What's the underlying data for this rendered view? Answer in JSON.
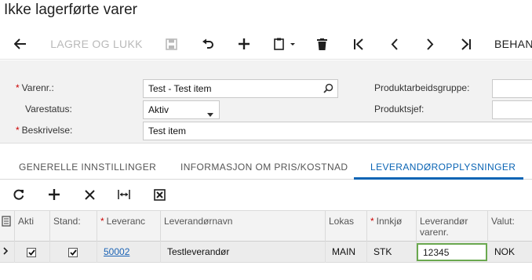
{
  "page": {
    "title": "Ikke lagerførte varer"
  },
  "toolbar": {
    "save_close_label": "LAGRE OG LUKK",
    "behan_label": "BEHAN",
    "icons": [
      "back-arrow-icon",
      "save-icon",
      "undo-icon",
      "plus-icon",
      "copy-paste-icon",
      "trash-icon",
      "first-record-icon",
      "prev-record-icon",
      "next-record-icon",
      "last-record-icon"
    ]
  },
  "form": {
    "varenr_label": "Varenr.:",
    "varenr_value": "Test - Test item",
    "varestatus_label": "Varestatus:",
    "varestatus_value": "Aktiv",
    "beskrivelse_label": "Beskrivelse:",
    "beskrivelse_value": "Test item",
    "produktarbeidsgruppe_label": "Produktarbeidsgruppe:",
    "produktsjef_label": "Produktsjef:",
    "required_mark": "*"
  },
  "tabs": [
    {
      "label": "GENERELLE INNSTILLINGER",
      "active": false
    },
    {
      "label": "INFORMASJON OM PRIS/KOSTNAD",
      "active": false
    },
    {
      "label": "LEVERANDØROPPLYSNINGER",
      "active": true
    }
  ],
  "grid": {
    "columns": {
      "aktiv": "Akti",
      "standard": "Stand:",
      "leverandor": "Leveranc",
      "leverandornavn": "Leverandørnavn",
      "lokasjon": "Lokas",
      "innkjoper": "Innkjø",
      "leverandor_varenr_line1": "Leverandør",
      "leverandor_varenr_line2": "varenr.",
      "valuta": "Valut:"
    },
    "rows": [
      {
        "aktiv": true,
        "standard": true,
        "leverandor": "50002",
        "leverandornavn": "Testleverandør",
        "lokasjon": "MAIN",
        "innkjoper": "STK",
        "leverandor_varenr": "12345",
        "valuta": "NOK"
      }
    ]
  },
  "colors": {
    "accent": "#0a64b4",
    "edit_border": "#6aa84f",
    "required": "#cc0000"
  }
}
